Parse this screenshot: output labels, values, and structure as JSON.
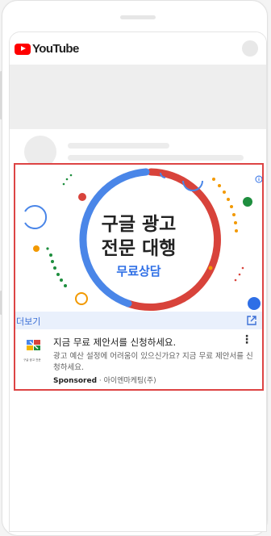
{
  "app": {
    "logo_text": "YouTube"
  },
  "banner": {
    "headline_line1": "구글 광고",
    "headline_line2": "전문 대행",
    "cta": "무료상담",
    "headline_color": "#222222",
    "cta_color": "#2f6fe6",
    "accent_blue": "#4a86e8",
    "accent_red": "#d8433b"
  },
  "ad": {
    "more_label": "더보기",
    "title": "지금 무료 제안서를 신청하세요.",
    "description": "광고 예산 설정에 어려움이 있으신가요? 지금 무료 제안서를 신청하세요.",
    "sponsored_label": "Sponsored",
    "separator": " · ",
    "advertiser": "아이엔마케팅(주)",
    "logo_caption": "구글 광고 전문",
    "menu_icon": "more-vert-icon",
    "external_icon": "open-in-new-icon",
    "highlight_color": "#dd4444"
  }
}
